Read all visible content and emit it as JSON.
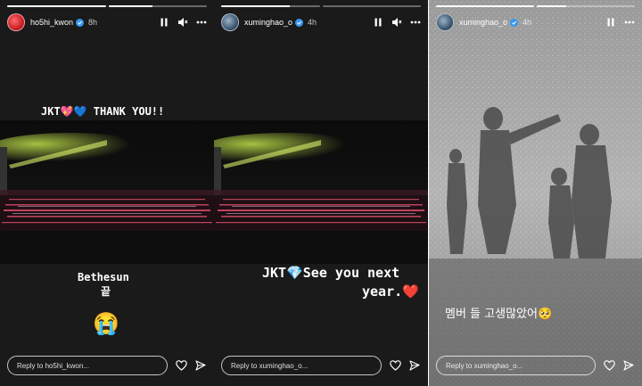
{
  "stories": [
    {
      "username": "ho5hi_kwon",
      "time": "8h",
      "caption_top": "JKT💖💙  THANK YOU!!",
      "caption_line1": "Bethesun",
      "caption_line2": "끝",
      "emoji": "😭",
      "reply_placeholder": "Reply to ho5hi_kwon..."
    },
    {
      "username": "xuminghao_o",
      "time": "4h",
      "caption_line1": "JKT💎See you next",
      "caption_line2": "year.❤️",
      "reply_placeholder": "Reply to xuminghao_o..."
    },
    {
      "username": "xuminghao_o",
      "time": "4h",
      "caption": "멤버 들 고생많았어🥺",
      "reply_placeholder": "Reply to xuminghao_o..."
    }
  ],
  "icons": {
    "pause": "pause-icon",
    "mute": "speaker-mute-icon",
    "more": "more-dots-icon",
    "verified": "verified-badge-icon",
    "like": "heart-icon",
    "share": "send-icon"
  },
  "colors": {
    "story_bg": "#1a1a1a",
    "verified_badge": "#3897f0",
    "heart": "#e0245e"
  }
}
